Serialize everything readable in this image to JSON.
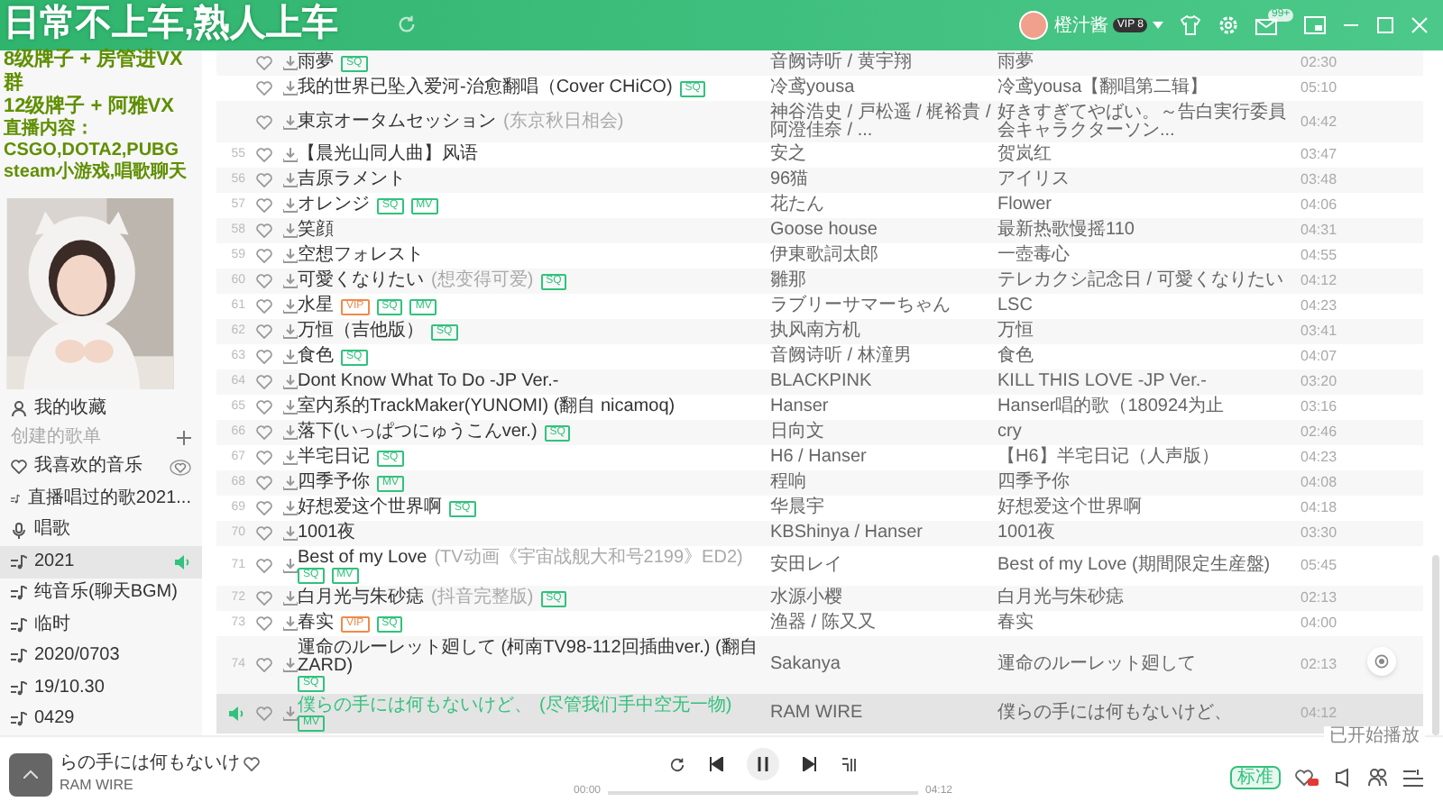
{
  "overlay_text": [
    "日常不上车,熟人上车",
    "8级牌子 + 房管进VX群",
    "12级牌子 + 阿雅VX",
    "直播内容：CSGO,DOTA2,PUBG",
    "steam小游戏,唱歌聊天"
  ],
  "header": {
    "user": {
      "name": "橙汁酱",
      "badge": "VIP 8"
    },
    "mail_badge": "99+"
  },
  "sidebar": {
    "collection": "我的收藏",
    "section_title": "创建的歌单",
    "items": [
      {
        "label": "我喜欢的音乐",
        "kind": "liked",
        "selected": false,
        "playing": false
      },
      {
        "label": "直播唱过的歌2021...",
        "kind": "playlist",
        "selected": false,
        "playing": false
      },
      {
        "label": "唱歌",
        "kind": "mic",
        "selected": false,
        "playing": false
      },
      {
        "label": "2021",
        "kind": "playlist",
        "selected": true,
        "playing": true
      },
      {
        "label": "纯音乐(聊天BGM)",
        "kind": "playlist",
        "selected": false,
        "playing": false
      },
      {
        "label": "临时",
        "kind": "playlist",
        "selected": false,
        "playing": false
      },
      {
        "label": "2020/0703",
        "kind": "playlist",
        "selected": false,
        "playing": false
      },
      {
        "label": "19/10.30",
        "kind": "playlist",
        "selected": false,
        "playing": false
      },
      {
        "label": "0429",
        "kind": "playlist",
        "selected": false,
        "playing": false
      }
    ]
  },
  "songs": [
    {
      "title": "雨夢",
      "tags": [
        {
          "text": "SQ",
          "color": "#31c27c"
        }
      ],
      "singer": "音阙诗听 / 黄宇翔",
      "album": "雨夢",
      "duration": "02:30",
      "playing": false
    },
    {
      "title": "我的世界已坠入爱河-治愈翻唱（Cover CHiCO)",
      "tags": [
        {
          "text": "SQ",
          "color": "#31c27c"
        }
      ],
      "singer": "冷鸢yousa",
      "album": "冷鸢yousa【翻唱第二辑】",
      "duration": "05:10",
      "playing": false
    },
    {
      "title": "東京オータムセッション",
      "subtitle": "(东京秋日相会)",
      "singer": "神谷浩史 / 戸松遥 / 梶裕貴 / 阿澄佳奈 / ...",
      "album": "好きすぎてやばい。～告白実行委員会キャラクターソン...",
      "duration": "04:42",
      "playing": false
    },
    {
      "index": "55",
      "title": "【晨光山同人曲】风语",
      "singer": "安之",
      "album": "贺岚红",
      "duration": "03:47",
      "playing": false
    },
    {
      "index": "56",
      "title": "吉原ラメント",
      "singer": "96猫",
      "album": "アイリス",
      "duration": "03:48",
      "playing": false
    },
    {
      "index": "57",
      "title": "オレンジ",
      "tags": [
        {
          "text": "SQ",
          "color": "#31c27c"
        },
        {
          "text": "MV",
          "color": "#31c27c"
        }
      ],
      "singer": "花たん",
      "album": "Flower",
      "duration": "04:06",
      "playing": false
    },
    {
      "index": "58",
      "title": "笑顔",
      "singer": "Goose house",
      "album": "最新热歌慢摇110",
      "duration": "04:31",
      "playing": false
    },
    {
      "index": "59",
      "title": "空想フォレスト",
      "singer": "伊東歌詞太郎",
      "album": "一壺毒心",
      "duration": "04:55",
      "playing": false
    },
    {
      "index": "60",
      "title": "可愛くなりたい",
      "subtitle": "(想变得可爱)",
      "tags": [
        {
          "text": "SQ",
          "color": "#31c27c"
        }
      ],
      "singer": "雛那",
      "album": "テレカクシ記念日 / 可愛くなりたい",
      "duration": "04:12",
      "playing": false
    },
    {
      "index": "61",
      "title": "水星",
      "tags": [
        {
          "text": "VIP",
          "color": "#f08a4b"
        },
        {
          "text": "SQ",
          "color": "#31c27c"
        },
        {
          "text": "MV",
          "color": "#31c27c"
        }
      ],
      "singer": "ラブリーサマーちゃん",
      "album": "LSC",
      "duration": "04:23",
      "playing": false
    },
    {
      "index": "62",
      "title": "万恒（吉他版）",
      "tags": [
        {
          "text": "SQ",
          "color": "#31c27c"
        }
      ],
      "singer": "执风南方机",
      "album": "万恒",
      "duration": "03:41",
      "playing": false
    },
    {
      "index": "63",
      "title": "食色",
      "tags": [
        {
          "text": "SQ",
          "color": "#31c27c"
        }
      ],
      "singer": "音阙诗听 / 林潼男",
      "album": "食色",
      "duration": "04:07",
      "playing": false
    },
    {
      "index": "64",
      "title": "Dont Know What To Do -JP Ver.-",
      "singer": "BLACKPINK",
      "album": "KILL THIS LOVE -JP Ver.-",
      "duration": "03:20",
      "playing": false
    },
    {
      "index": "65",
      "title": "室内系的TrackMaker(YUNOMI) (翻自 nicamoq)",
      "singer": "Hanser",
      "album": "Hanser唱的歌（180924为止",
      "duration": "03:16",
      "playing": false
    },
    {
      "index": "66",
      "title": "落下(いっぱつにゅうこんver.)",
      "tags": [
        {
          "text": "SQ",
          "color": "#31c27c"
        }
      ],
      "singer": "日向文",
      "album": "cry",
      "duration": "02:46",
      "playing": false
    },
    {
      "index": "67",
      "title": "半宅日记",
      "tags": [
        {
          "text": "SQ",
          "color": "#31c27c"
        }
      ],
      "singer": "H6 / Hanser",
      "album": "【H6】半宅日记（人声版）",
      "duration": "04:23",
      "playing": false
    },
    {
      "index": "68",
      "title": "四季予你",
      "tags": [
        {
          "text": "MV",
          "color": "#31c27c"
        }
      ],
      "singer": "程响",
      "album": "四季予你",
      "duration": "04:08",
      "playing": false
    },
    {
      "index": "69",
      "title": "好想爱这个世界啊",
      "tags": [
        {
          "text": "SQ",
          "color": "#31c27c"
        }
      ],
      "singer": "华晨宇",
      "album": "好想爱这个世界啊",
      "duration": "04:18",
      "playing": false
    },
    {
      "index": "70",
      "title": "1001夜",
      "singer": "KBShinya / Hanser",
      "album": "1001夜",
      "duration": "03:30",
      "playing": false
    },
    {
      "index": "71",
      "title": "Best of my Love",
      "subtitle": "(TV动画《宇宙战舰大和号2199》ED2)",
      "tags": [
        {
          "text": "SQ",
          "color": "#31c27c"
        },
        {
          "text": "MV",
          "color": "#31c27c"
        }
      ],
      "singer": "安田レイ",
      "album": "Best of my Love (期間限定生産盤)",
      "duration": "05:45",
      "playing": false
    },
    {
      "index": "72",
      "title": "白月光与朱砂痣",
      "subtitle": "(抖音完整版)",
      "tags": [
        {
          "text": "SQ",
          "color": "#31c27c"
        }
      ],
      "singer": "水源小樱",
      "album": "白月光与朱砂痣",
      "duration": "02:13",
      "playing": false
    },
    {
      "index": "73",
      "title": "春实",
      "tags": [
        {
          "text": "VIP",
          "color": "#f08a4b"
        },
        {
          "text": "SQ",
          "color": "#31c27c"
        }
      ],
      "singer": "渔器 / 陈又又",
      "album": "春实",
      "duration": "04:00",
      "playing": false
    },
    {
      "index": "74",
      "title": "運命のルーレット廻して (柯南TV98-112回插曲ver.) (翻自 ZARD)",
      "tags": [
        {
          "text": "SQ",
          "color": "#31c27c"
        }
      ],
      "singer": "Sakanya",
      "album": "運命のルーレット廻して",
      "duration": "02:13",
      "playing": false
    },
    {
      "title": "僕らの手には何もないけど、",
      "subtitle": "(尽管我们手中空无一物)",
      "tags": [
        {
          "text": "MV",
          "color": "#31c27c"
        }
      ],
      "singer": "RAM WIRE",
      "album": "僕らの手には何もないけど、",
      "duration": "04:12",
      "playing": true
    }
  ],
  "player": {
    "title": "らの手には何もないけ",
    "artist": "RAM WIRE",
    "elapsed": "00:00",
    "total": "04:12",
    "level": 0,
    "quality": "标准",
    "tooltip": "已开始播放"
  }
}
